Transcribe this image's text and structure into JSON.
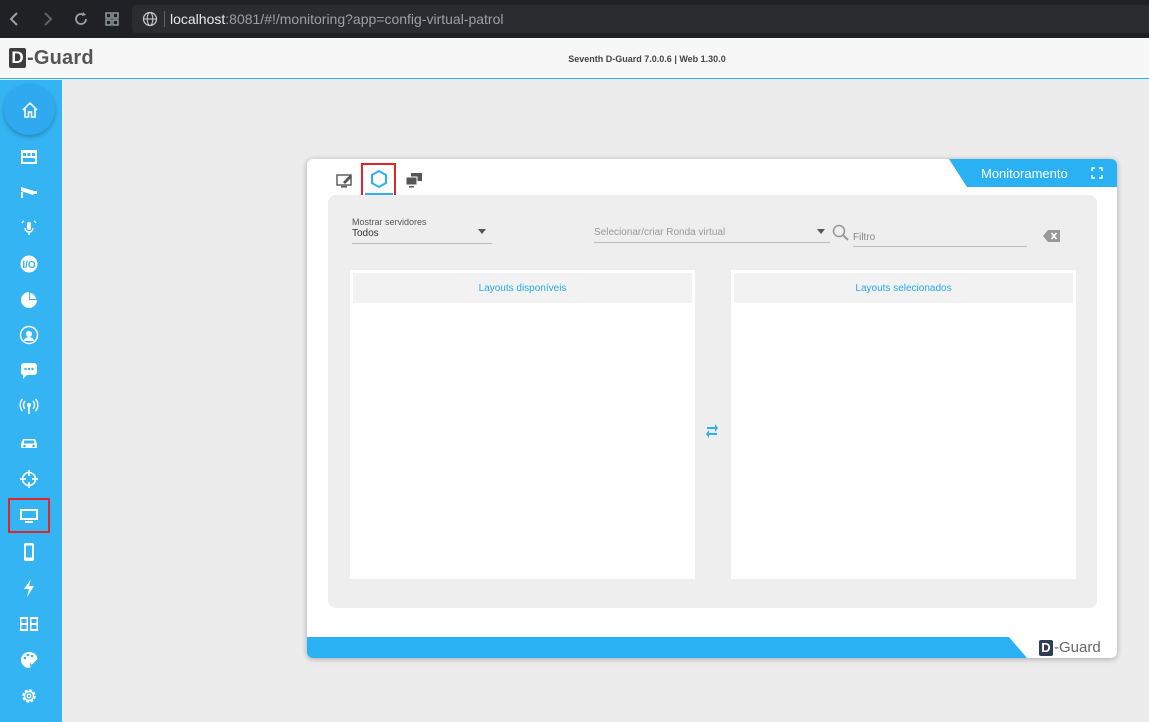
{
  "browser": {
    "url_host": "localhost",
    "url_rest": ":8081/#!/monitoring?app=config-virtual-patrol"
  },
  "header": {
    "logo_d": "D",
    "logo_rest": "-Guard",
    "version": "Seventh D-Guard 7.0.0.6 | Web 1.30.0"
  },
  "sidebar": {
    "items": [
      {
        "icon": "home-icon"
      },
      {
        "icon": "network-icon"
      },
      {
        "icon": "camera-icon"
      },
      {
        "icon": "microphone-wifi-icon"
      },
      {
        "icon": "io-icon"
      },
      {
        "icon": "pie-chart-icon"
      },
      {
        "icon": "headset-icon"
      },
      {
        "icon": "chat-icon"
      },
      {
        "icon": "radio-signal-icon"
      },
      {
        "icon": "car-icon"
      },
      {
        "icon": "target-icon"
      },
      {
        "icon": "monitor-icon",
        "selected": true
      },
      {
        "icon": "smartphone-icon"
      },
      {
        "icon": "lightning-icon"
      },
      {
        "icon": "layout-grid-icon"
      },
      {
        "icon": "palette-icon"
      },
      {
        "icon": "settings-icon"
      }
    ]
  },
  "panel": {
    "title": "Monitoramento",
    "tabs": [
      {
        "icon": "monitor-edit-icon"
      },
      {
        "icon": "hexagon-patrol-icon",
        "active": true
      },
      {
        "icon": "multi-monitor-icon"
      }
    ],
    "servers": {
      "label": "Mostrar servidores",
      "value": "Todos"
    },
    "patrol_select": {
      "placeholder": "Selecionar/criar Ronda virtual"
    },
    "filter": {
      "placeholder": "Filtro"
    },
    "available_header": "Layouts disponíveis",
    "selected_header": "Layouts selecionados",
    "footer_logo_d": "D",
    "footer_logo_rest": "-Guard"
  },
  "colors": {
    "accent": "#29b1f4",
    "sidebar": "#34b4f2",
    "highlight": "#e0262b"
  }
}
